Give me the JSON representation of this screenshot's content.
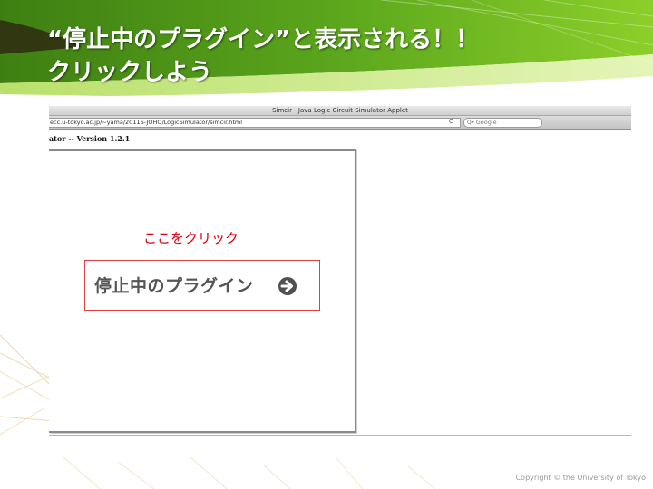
{
  "slide": {
    "title_line1": "“停止中のプラグイン”と表示される！！",
    "title_line2": "クリックしよう",
    "copyright": "Copyright © the University of Tokyo"
  },
  "browser": {
    "window_title": "Simcir - Java Logic Circuit Simulator Applet",
    "url": "ecc.u-tokyo.ac.jp/~yama/2011S-JOHO/LogicSimulator/simcir.html",
    "reload_symbol": "C",
    "search_placeholder": "Google",
    "search_icon_glyph": "Q▾",
    "page_heading": "ator -- Version 1.2.1"
  },
  "applet": {
    "annotation": "ここをクリック",
    "plugin_button_label": "停止中のプラグイン"
  },
  "colors": {
    "header_green": "#5aa51c",
    "annotation_red": "#e0000f",
    "plugin_text": "#555555"
  }
}
